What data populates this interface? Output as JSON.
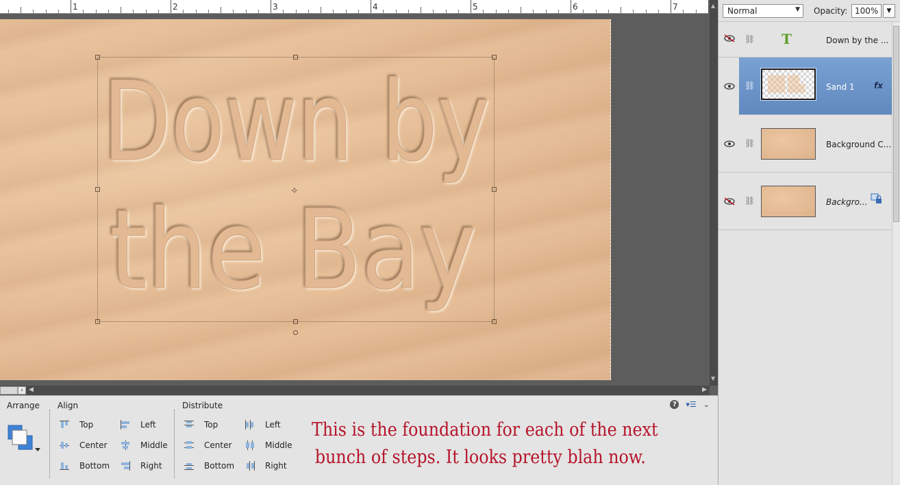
{
  "ruler": {
    "numbers": [
      "1",
      "2",
      "3",
      "4",
      "5",
      "6",
      "7"
    ]
  },
  "document": {
    "sand_text_line1": "Down by",
    "sand_text_line2": "the Bay"
  },
  "options_bar": {
    "arrange_label": "Arrange",
    "align_label": "Align",
    "distribute_label": "Distribute",
    "align": {
      "top": "Top",
      "center": "Center",
      "bottom": "Bottom",
      "left": "Left",
      "middle": "Middle",
      "right": "Right"
    },
    "distribute": {
      "top": "Top",
      "center": "Center",
      "bottom": "Bottom",
      "left": "Left",
      "middle": "Middle",
      "right": "Right"
    },
    "help_icon": "?",
    "caption_line1": "This is the foundation for each of the next",
    "caption_line2": "bunch of steps. It looks pretty blah now."
  },
  "layers_panel": {
    "blend_mode": "Normal",
    "opacity_label": "Opacity:",
    "opacity_value": "100%",
    "layers": [
      {
        "name": "Down by the ...",
        "type": "text",
        "visible": false,
        "selected": false
      },
      {
        "name": "Sand 1",
        "type": "image",
        "visible": true,
        "selected": true,
        "fx": "fx"
      },
      {
        "name": "Background C...",
        "type": "image",
        "visible": true,
        "selected": false
      },
      {
        "name": "Backgro...",
        "type": "image",
        "visible": false,
        "selected": false,
        "locked": true
      }
    ]
  },
  "colors": {
    "sand": "#e5bd96",
    "selected_layer": "#6a93c8",
    "caption": "#b5142a",
    "text_layer_icon": "#5d9e2c"
  }
}
